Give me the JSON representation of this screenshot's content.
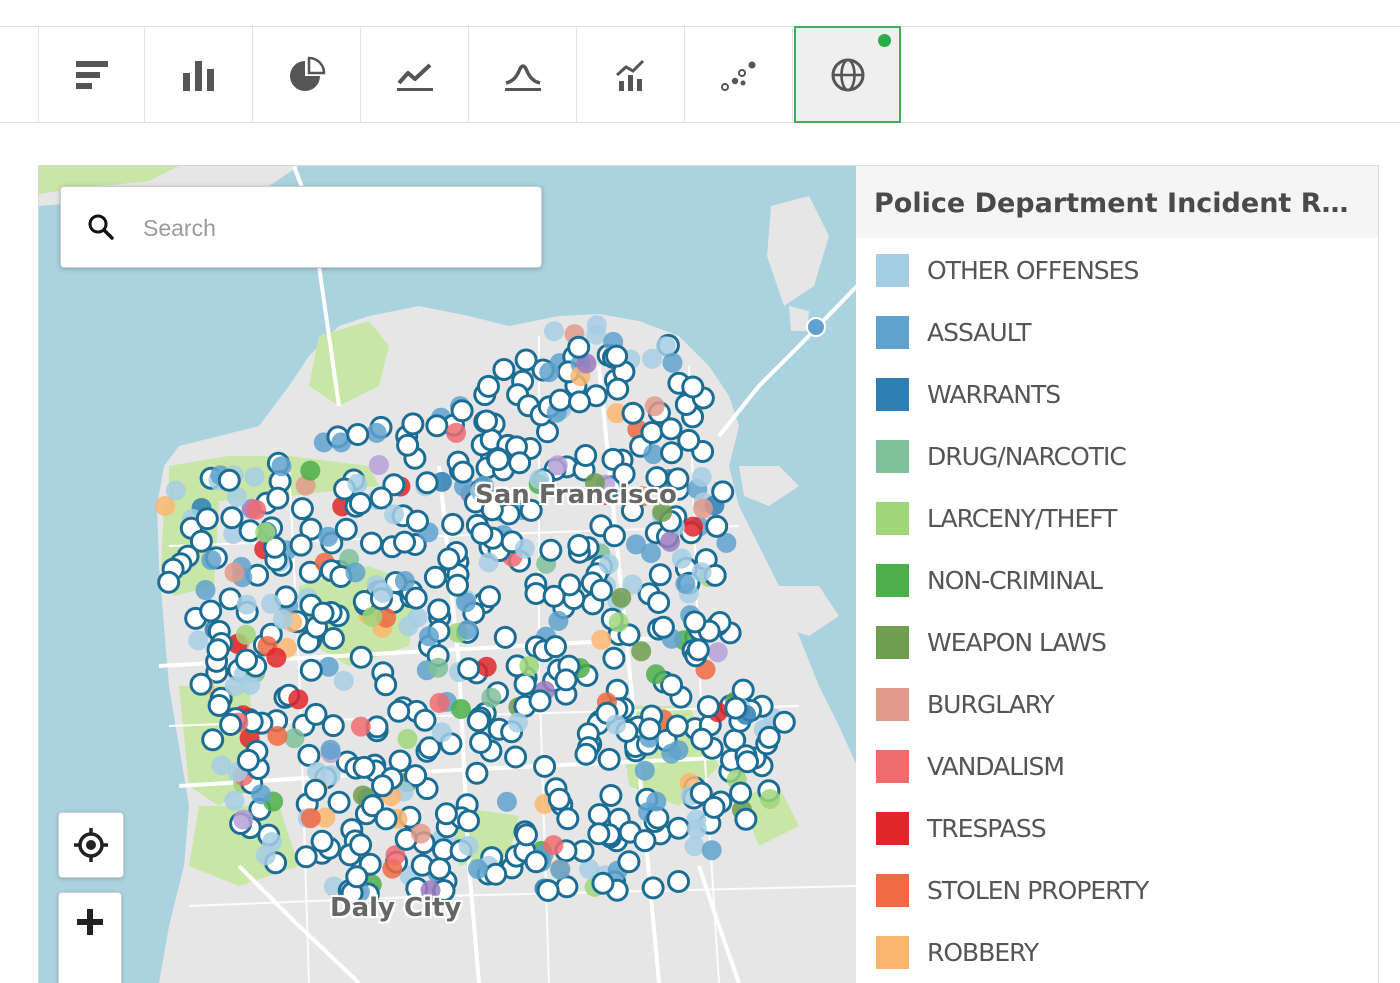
{
  "toolbar": {
    "buttons": [
      {
        "name": "horizontal-bar-chart-icon",
        "active": false
      },
      {
        "name": "bar-chart-icon",
        "active": false
      },
      {
        "name": "pie-chart-icon",
        "active": false
      },
      {
        "name": "line-chart-icon",
        "active": false
      },
      {
        "name": "area-chart-icon",
        "active": false
      },
      {
        "name": "combo-chart-icon",
        "active": false
      },
      {
        "name": "scatter-chart-icon",
        "active": false
      },
      {
        "name": "globe-icon",
        "active": true
      }
    ],
    "active_indicator_color": "#27ae4b"
  },
  "map": {
    "search": {
      "placeholder": "Search",
      "value": ""
    },
    "labels": {
      "city_main": "San Francisco",
      "city_south": "Daly City"
    },
    "controls": [
      "locate-icon",
      "zoom-in-icon"
    ],
    "colors": {
      "water": "#aad3df",
      "park": "#c8e6a5",
      "land": "#e6e6e6",
      "road": "#ffffff",
      "marker_outline": "#1b6d94"
    }
  },
  "legend": {
    "title": "Police Department Incident Reports",
    "items": [
      {
        "label": "OTHER OFFENSES",
        "color": "#a6cee3"
      },
      {
        "label": "ASSAULT",
        "color": "#5fa2cd"
      },
      {
        "label": "WARRANTS",
        "color": "#2e7fb4"
      },
      {
        "label": "DRUG/NARCOTIC",
        "color": "#7fbf9a"
      },
      {
        "label": "LARCENY/THEFT",
        "color": "#9fd67a"
      },
      {
        "label": "NON-CRIMINAL",
        "color": "#4caf4a"
      },
      {
        "label": "WEAPON LAWS",
        "color": "#6e9e4e"
      },
      {
        "label": "BURGLARY",
        "color": "#e29a8a"
      },
      {
        "label": "VANDALISM",
        "color": "#ee6b6e"
      },
      {
        "label": "TRESPASS",
        "color": "#e0262a"
      },
      {
        "label": "STOLEN PROPERTY",
        "color": "#f06a43"
      },
      {
        "label": "ROBBERY",
        "color": "#fbb66e"
      }
    ]
  }
}
